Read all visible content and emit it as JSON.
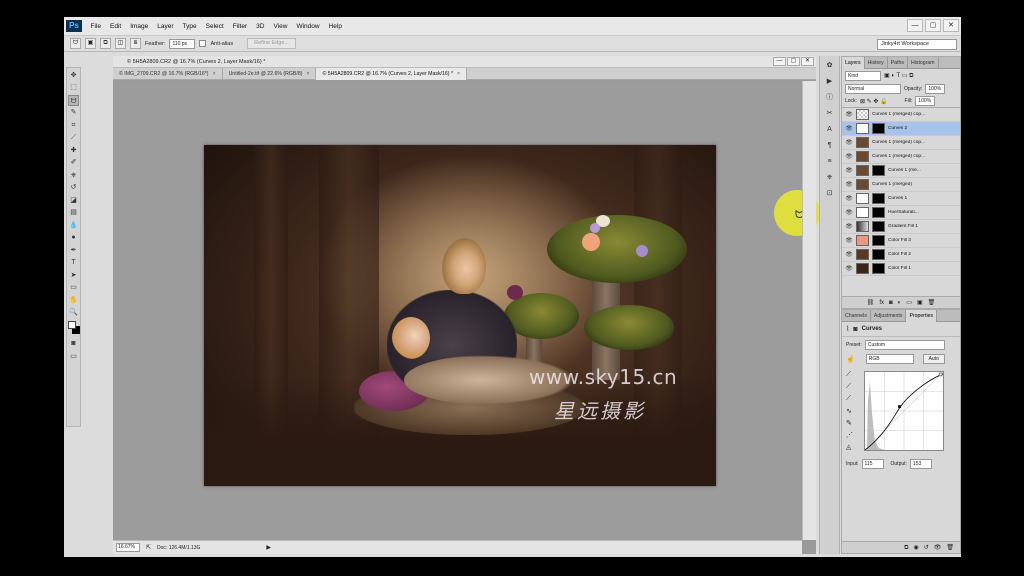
{
  "app": {
    "logo": "Ps",
    "menu": [
      "File",
      "Edit",
      "Image",
      "Layer",
      "Type",
      "Select",
      "Filter",
      "3D",
      "View",
      "Window",
      "Help"
    ],
    "window_controls": [
      "—",
      "▢",
      "✕"
    ]
  },
  "options": {
    "feather_label": "Feather:",
    "feather_value": "110 px",
    "antialias_label": "Anti-alias",
    "refine_edge": "Refine Edge...",
    "workspace": "Jinky4rt Workspace"
  },
  "document": {
    "title": "© 5H5A2809.CR2 @ 16.7% (Curves 2, Layer Mask/16) *",
    "tabs": [
      {
        "label": "© IMG_2709.CR2 @ 16.7% (RGB/16*)",
        "close": "×"
      },
      {
        "label": "Untitled-2e.tif @ 22.6% (RGB/8)",
        "close": "×"
      },
      {
        "label": "© 5H5A2809.CR2 @ 16.7% (Curves 2, Layer Mask/16) *",
        "close": "×"
      }
    ],
    "zoom": "16.67%",
    "doc_size": "Doc: 126.4M/1.13G",
    "watermark": "www.sky15.cn",
    "watermark_cn": "星远摄影"
  },
  "layers_panel": {
    "tabs": [
      "Layers",
      "History",
      "Paths",
      "Histogram"
    ],
    "kind": "Kind",
    "blend_mode": "Normal",
    "opacity_label": "Opacity:",
    "opacity": "100%",
    "lock_label": "Lock:",
    "fill_label": "Fill:",
    "fill": "100%",
    "layers": [
      {
        "name": "Curves 1 (merged) cop...",
        "selected": false
      },
      {
        "name": "Curves 2",
        "selected": true
      },
      {
        "name": "Curves 1 (merged) cop...",
        "selected": false
      },
      {
        "name": "Curves 1 (merged) cop...",
        "selected": false
      },
      {
        "name": "Curves 1 (me...",
        "selected": false
      },
      {
        "name": "Curves 1 (merged)",
        "selected": false
      },
      {
        "name": "Curves 1",
        "selected": false
      },
      {
        "name": "Hue/Saturati...",
        "selected": false
      },
      {
        "name": "Gradient Fill 1",
        "selected": false
      },
      {
        "name": "Color Fill 3",
        "selected": false
      },
      {
        "name": "Color Fill 2",
        "selected": false
      },
      {
        "name": "Color Fill 1",
        "selected": false
      }
    ]
  },
  "properties_panel": {
    "tabs": [
      "Channels",
      "Adjustments",
      "Properties"
    ],
    "title": "Curves",
    "preset_label": "Preset:",
    "preset": "Custom",
    "channel": "RGB",
    "auto": "Auto",
    "input_label": "Input:",
    "input": "115",
    "output_label": "Output:",
    "output": "153"
  }
}
